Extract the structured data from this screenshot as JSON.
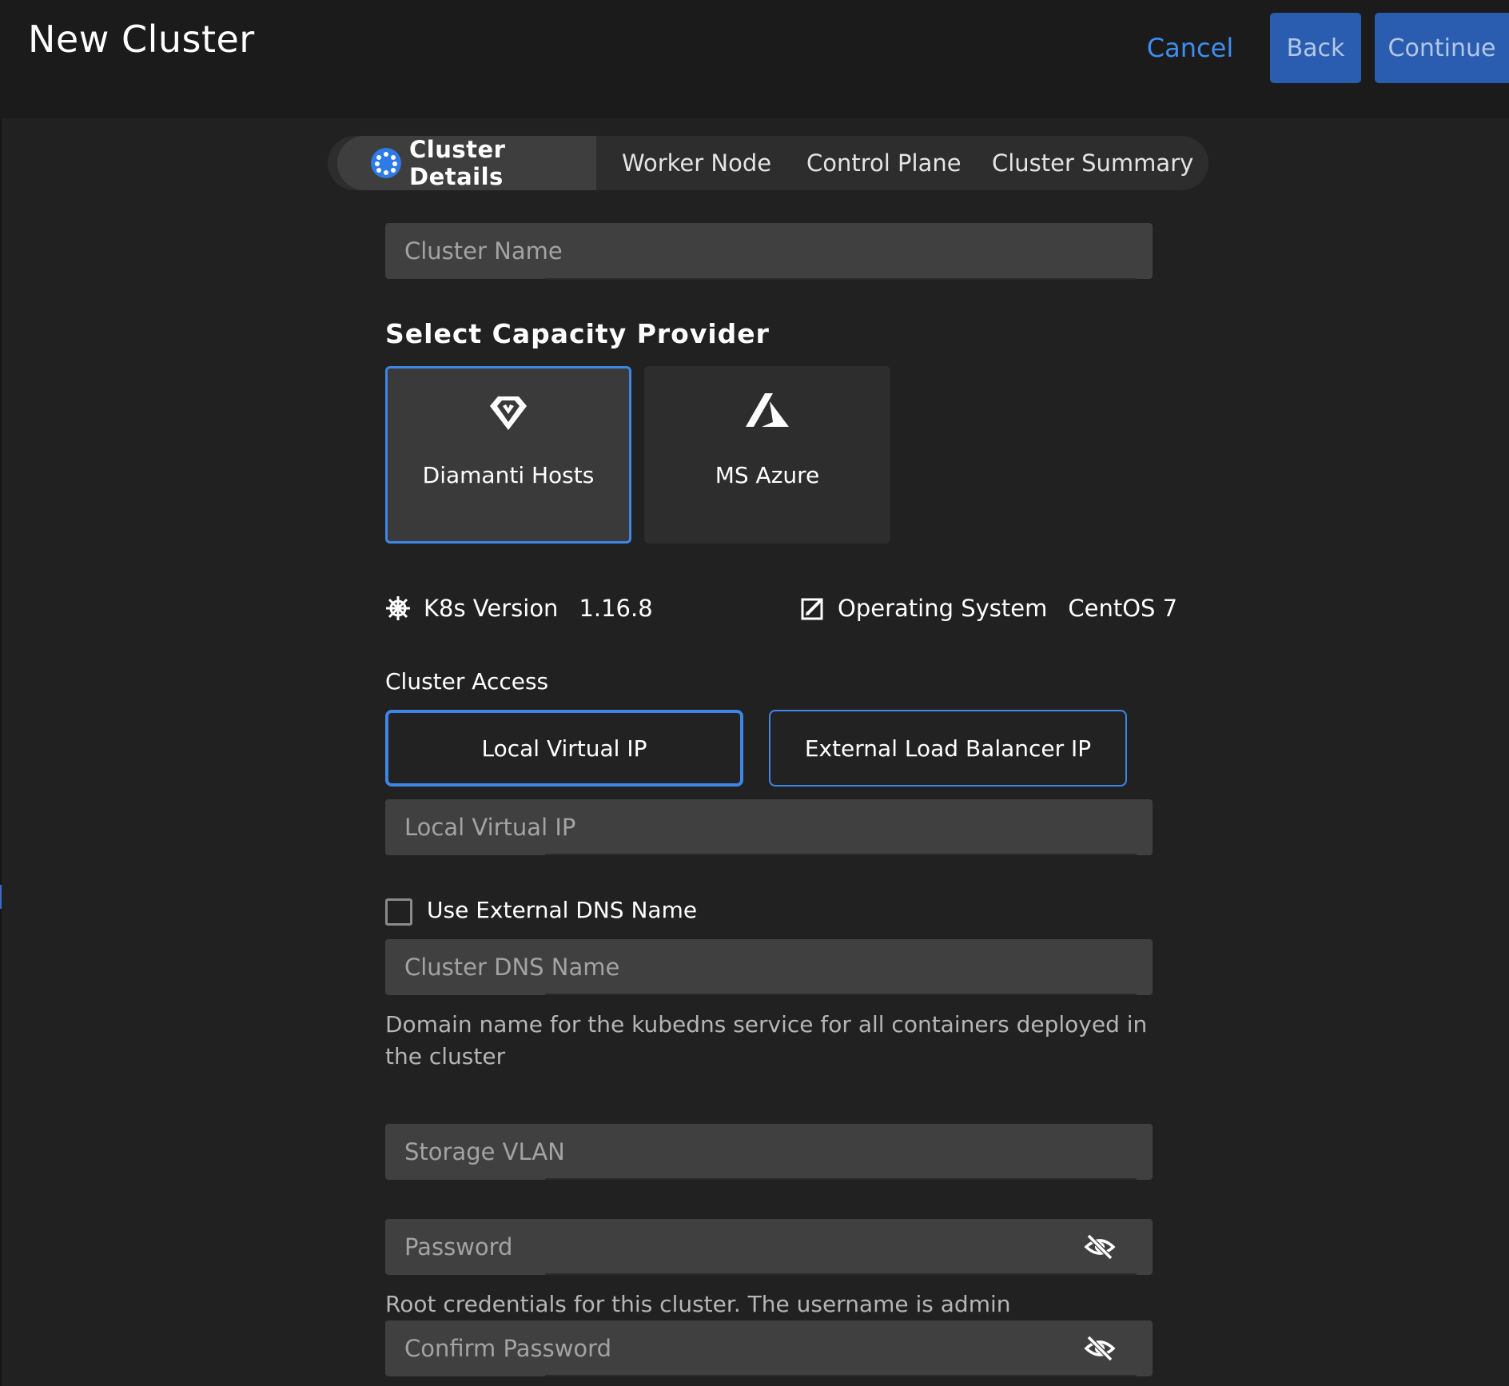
{
  "header": {
    "title": "New Cluster",
    "cancel_label": "Cancel",
    "back_label": "Back",
    "continue_label": "Continue"
  },
  "stepper": {
    "steps": [
      {
        "label": "Cluster Details",
        "active": true
      },
      {
        "label": "Worker Node",
        "active": false
      },
      {
        "label": "Control Plane",
        "active": false
      },
      {
        "label": "Cluster Summary",
        "active": false
      }
    ]
  },
  "form": {
    "cluster_name": {
      "placeholder": "Cluster Name",
      "value": ""
    },
    "capacity_provider": {
      "title": "Select Capacity Provider",
      "options": [
        {
          "label": "Diamanti Hosts",
          "icon": "diamanti-icon",
          "selected": true
        },
        {
          "label": "MS Azure",
          "icon": "azure-icon",
          "selected": false
        }
      ]
    },
    "k8s_version": {
      "label": "K8s Version",
      "value": "1.16.8",
      "icon": "kubernetes-icon"
    },
    "operating_system": {
      "label": "Operating System",
      "value": "CentOS 7",
      "icon": "os-icon"
    },
    "cluster_access": {
      "title": "Cluster Access",
      "options": [
        {
          "label": "Local Virtual IP",
          "selected": true
        },
        {
          "label": "External Load Balancer IP",
          "selected": false
        }
      ]
    },
    "local_virtual_ip": {
      "placeholder": "Local Virtual IP",
      "value": ""
    },
    "use_external_dns": {
      "label": "Use External DNS Name",
      "checked": false
    },
    "cluster_dns_name": {
      "placeholder": "Cluster DNS Name",
      "value": "",
      "help": "Domain name for the kubedns service for all containers deployed in the cluster"
    },
    "storage_vlan": {
      "placeholder": "Storage VLAN",
      "value": ""
    },
    "password": {
      "placeholder": "Password",
      "value": "",
      "help": "Root credentials for this cluster. The username is admin"
    },
    "confirm_password": {
      "placeholder": "Confirm Password",
      "value": ""
    }
  },
  "colors": {
    "accent": "#3d86e6",
    "primary_button": "#2a5db0",
    "link": "#3d8ef0",
    "background": "#212121",
    "field": "#404040"
  }
}
